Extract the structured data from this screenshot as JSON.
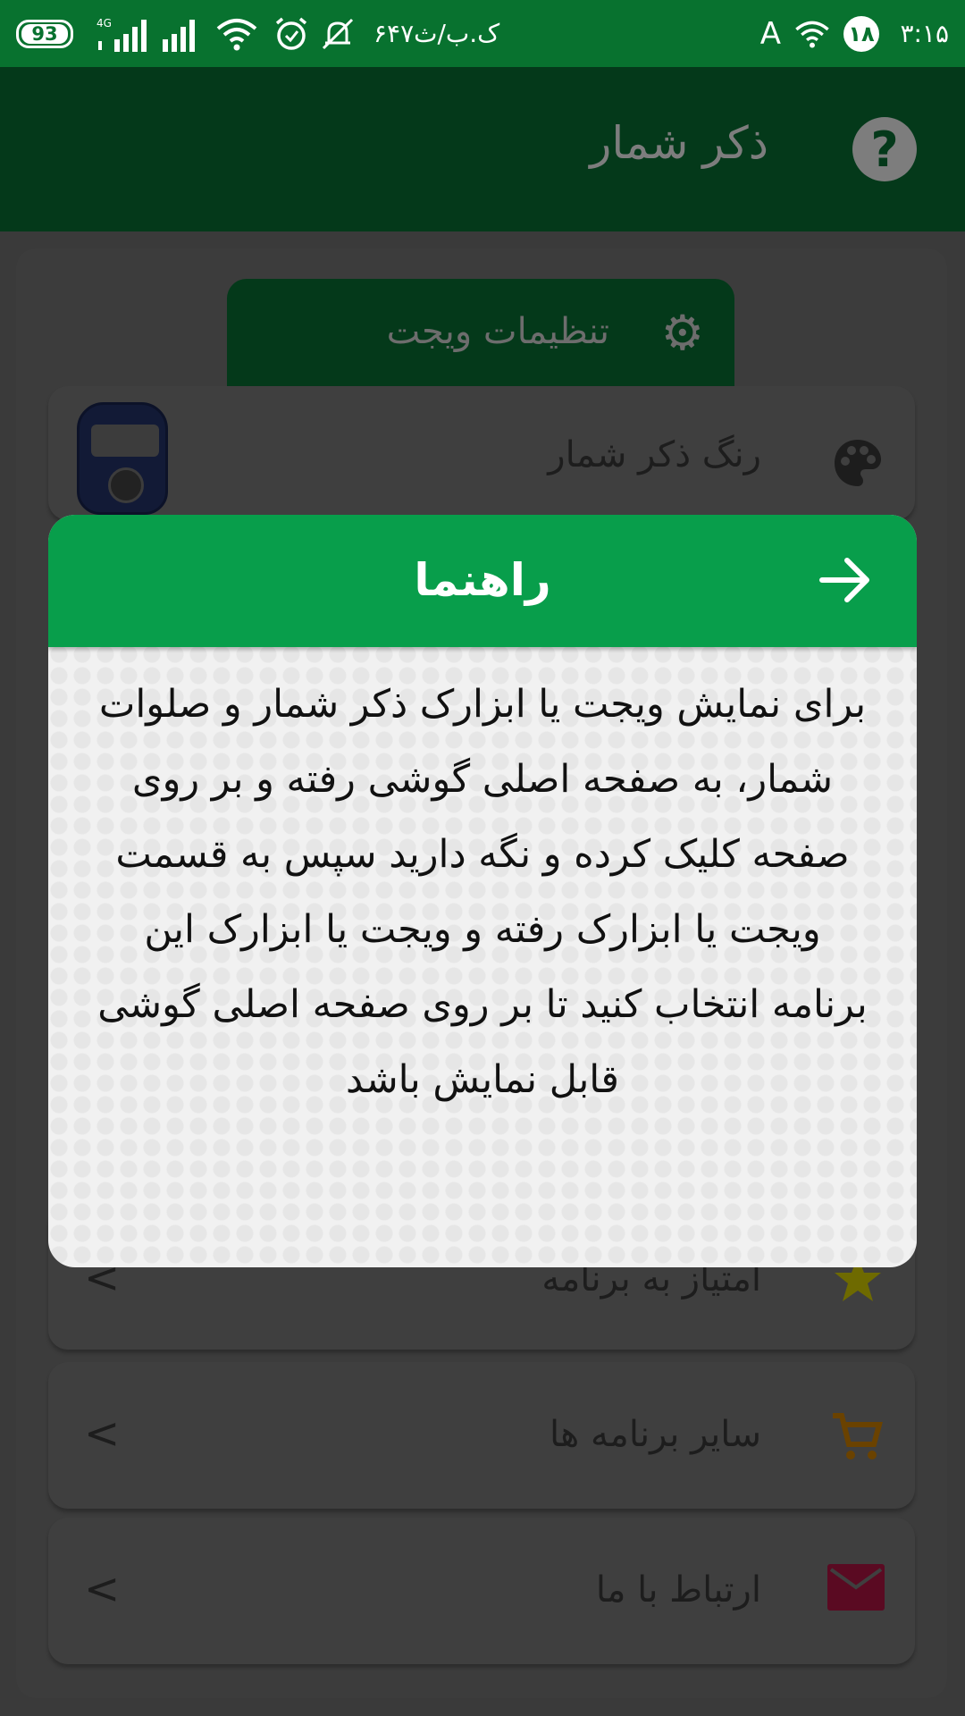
{
  "status_bar": {
    "time": "۳:۱۵",
    "notification_count": "۱۸",
    "aa_indicator": "A",
    "carrier": "۶۴۷ک.ب/ث",
    "network_type": "4G",
    "battery_level": "93"
  },
  "app_bar": {
    "title": "ذکر شمار",
    "help_label": "?"
  },
  "widget_tab": {
    "label": "تنظیمات ویجت"
  },
  "cards": {
    "counter_color": "رنگ ذکر شمار",
    "rate_app": "امتیاز به برنامه",
    "other_apps": "سایر برنامه ها",
    "contact_us": "ارتباط با ما",
    "chevron": "<"
  },
  "dialog": {
    "title": "راهنما",
    "body": "برای نمایش ویجت یا ابزارک ذکر شمار و صلوات شمار، به صفحه اصلی گوشی رفته و بر روی صفحه کلیک کرده و نگه دارید سپس به قسمت ویجت یا ابزارک رفته و ویجت یا ابزارک این برنامه انتخاب کنید تا بر روی صفحه اصلی گوشی قابل نمایش باشد"
  },
  "colors": {
    "status_bar": "#08722f",
    "app_bar_dimmed": "#04391a",
    "dialog_header": "#089e4b",
    "dialog_body": "#f1f1f1",
    "star_dimmed": "#6e6a00",
    "cart_dimmed": "#6a4200",
    "mail_dimmed": "#5a0a22"
  },
  "icons": [
    "battery-icon",
    "signal-icon",
    "wifi-icon",
    "alarm-icon",
    "mute-icon",
    "help-icon",
    "gear-icon",
    "palette-icon",
    "star-icon",
    "cart-icon",
    "mail-icon",
    "arrow-forward-icon",
    "chevron-left-icon"
  ]
}
